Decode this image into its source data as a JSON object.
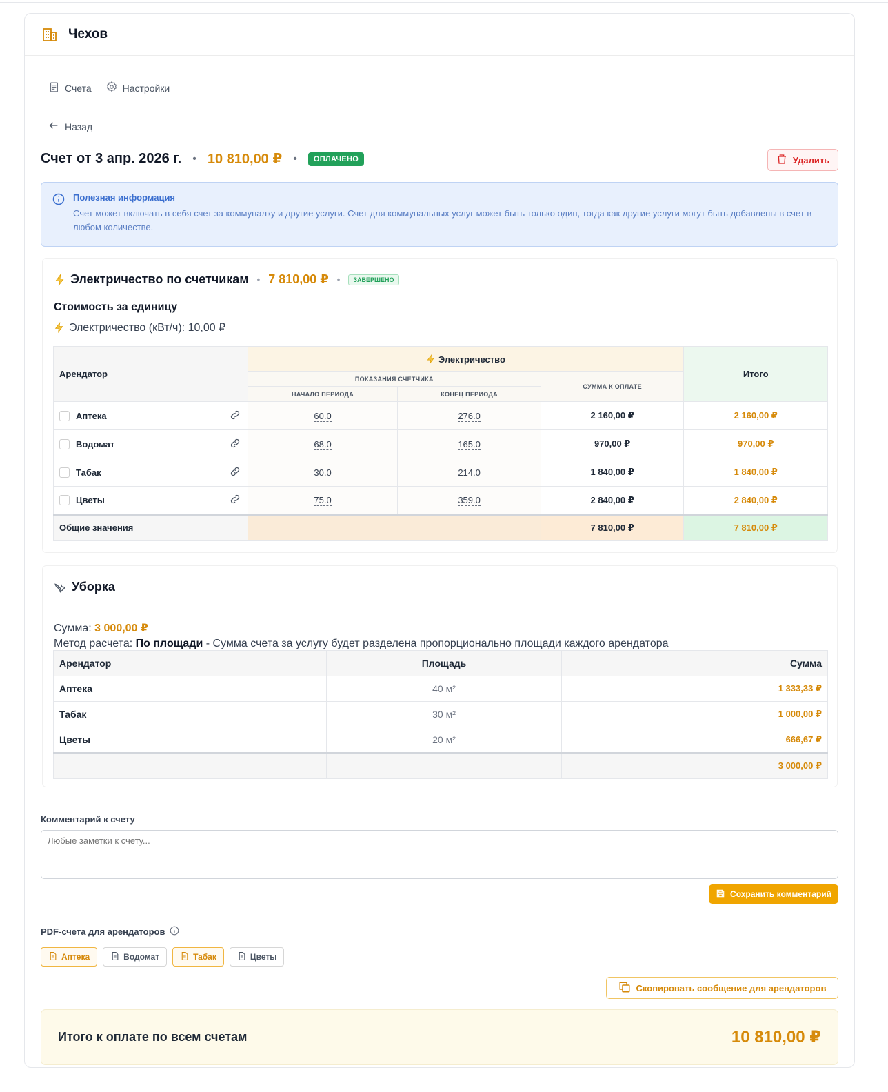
{
  "app": {
    "title": "Чехов"
  },
  "nav": {
    "invoices": "Счета",
    "settings": "Настройки",
    "back": "Назад"
  },
  "invoice": {
    "title": "Счет от 3 апр. 2026 г.",
    "amount": "10 810,00 ₽",
    "status": "ОПЛАЧЕНО",
    "delete_label": "Удалить"
  },
  "info": {
    "title": "Полезная информация",
    "text": "Счет может включать в себя счет за коммуналку и другие услуги. Счет для коммунальных услуг может быть только один, тогда как другие услуги могут быть добавлены в счет в любом количестве."
  },
  "electricity": {
    "title": "Электричество по счетчикам",
    "amount": "7 810,00 ₽",
    "status": "ЗАВЕРШЕНО",
    "unit_heading": "Стоимость за единицу",
    "unit_line": "Электричество (кВт/ч): 10,00 ₽",
    "headers": {
      "tenant": "Арендатор",
      "group": "Электричество",
      "readings": "ПОКАЗАНИЯ СЧЕТЧИКА",
      "start": "НАЧАЛО ПЕРИОДА",
      "end": "КОНЕЦ ПЕРИОДА",
      "due": "СУММА К ОПЛАТЕ",
      "total": "Итого"
    },
    "rows": [
      {
        "tenant": "Аптека",
        "start": "60.0",
        "end": "276.0",
        "due": "2 160,00 ₽",
        "total": "2 160,00 ₽"
      },
      {
        "tenant": "Водомат",
        "start": "68.0",
        "end": "165.0",
        "due": "970,00 ₽",
        "total": "970,00 ₽"
      },
      {
        "tenant": "Табак",
        "start": "30.0",
        "end": "214.0",
        "due": "1 840,00 ₽",
        "total": "1 840,00 ₽"
      },
      {
        "tenant": "Цветы",
        "start": "75.0",
        "end": "359.0",
        "due": "2 840,00 ₽",
        "total": "2 840,00 ₽"
      }
    ],
    "totals": {
      "label": "Общие значения",
      "due": "7 810,00 ₽",
      "total": "7 810,00 ₽"
    }
  },
  "cleaning": {
    "title": "Уборка",
    "sum_label": "Сумма:",
    "sum_value": "3 000,00 ₽",
    "method_label": "Метод расчета:",
    "method_value": "По площади",
    "method_desc": " - Сумма счета за услугу будет разделена пропорционально площади каждого арендатора",
    "headers": {
      "tenant": "Арендатор",
      "area": "Площадь",
      "sum": "Сумма"
    },
    "rows": [
      {
        "tenant": "Аптека",
        "area": "40 м²",
        "sum": "1 333,33 ₽"
      },
      {
        "tenant": "Табак",
        "area": "30 м²",
        "sum": "1 000,00 ₽"
      },
      {
        "tenant": "Цветы",
        "area": "20 м²",
        "sum": "666,67 ₽"
      }
    ],
    "total": "3 000,00 ₽"
  },
  "comment": {
    "label": "Комментарий к счету",
    "placeholder": "Любые заметки к счету...",
    "save_label": "Сохранить комментарий"
  },
  "pdf": {
    "label": "PDF-счета для арендаторов",
    "chips": [
      "Аптека",
      "Водомат",
      "Табак",
      "Цветы"
    ]
  },
  "copy_label": "Скопировать сообщение для арендаторов",
  "grand_total": {
    "label": "Итого к оплате по всем счетам",
    "value": "10 810,00 ₽"
  },
  "colors": {
    "accent": "#d68a0a",
    "paid": "#22a15a",
    "danger": "#dc2626",
    "info": "#3b6fcf"
  }
}
